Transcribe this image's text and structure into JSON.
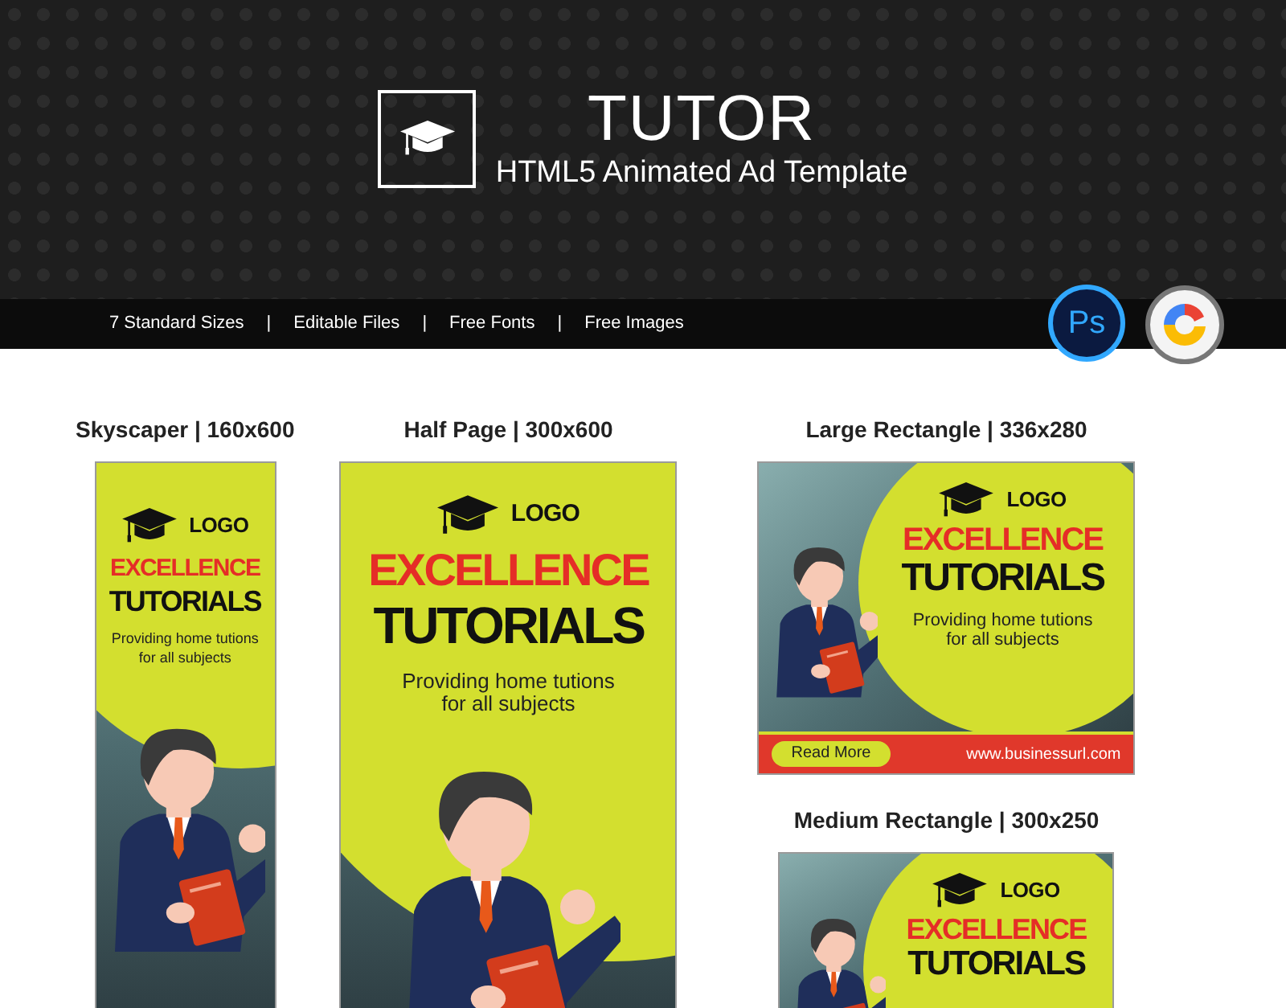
{
  "header": {
    "title": "TUTOR",
    "subtitle": "HTML5 Animated Ad Template"
  },
  "features": [
    "7 Standard Sizes",
    "Editable Files",
    "Free Fonts",
    "Free Images"
  ],
  "separator": "|",
  "app_badges": [
    {
      "kind": "ps",
      "label": "Ps"
    },
    {
      "kind": "ring"
    }
  ],
  "columns": [
    {
      "banners": [
        {
          "kind": "narrow_tall",
          "caption": "Skyscaper | 160x600",
          "logo": "LOGO",
          "headline": "EXCELLENCE",
          "headline_2": "TUTORIALS",
          "tagline": "Providing home tutions for all subjects"
        }
      ]
    },
    {
      "banners": [
        {
          "kind": "wide_tall",
          "caption": "Half Page | 300x600",
          "logo": "LOGO",
          "headline": "EXCELLENCE",
          "headline_2": "TUTORIALS",
          "tagline": "Providing home tutions for all subjects"
        }
      ]
    },
    {
      "banners": [
        {
          "kind": "large_landscape",
          "caption": "Large Rectangle | 336x280",
          "logo": "LOGO",
          "headline": "EXCELLENCE",
          "headline_2": "TUTORIALS",
          "tagline": "Providing home tutions for all subjects",
          "button": "Read More",
          "url": "www.businessurl.com"
        },
        {
          "kind": "medium_landscape",
          "caption": "Medium Rectangle | 300x250",
          "logo": "LOGO",
          "headline": "EXCELLENCE",
          "headline_2": "TUTORIALS"
        }
      ]
    }
  ]
}
